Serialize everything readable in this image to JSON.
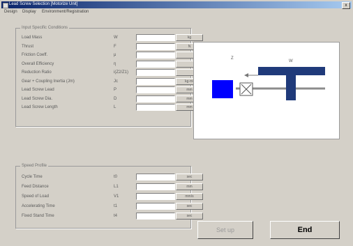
{
  "window": {
    "title": "Lead Screw Selection [Motorize Unit]",
    "close_glyph": "x"
  },
  "menu": [
    "Design",
    "Display",
    "Environment/Registration"
  ],
  "conditions": {
    "title": "Input Specific Conditions",
    "rows": [
      {
        "label": "Load Mass",
        "symbol": "W",
        "value": "",
        "unit": "kg"
      },
      {
        "label": "Thrust",
        "symbol": "F",
        "value": "",
        "unit": "N"
      },
      {
        "label": "Friction Coeff.",
        "symbol": "μ",
        "value": "",
        "unit": ""
      },
      {
        "label": "Overall Efficiency",
        "symbol": "η",
        "value": "",
        "unit": ""
      },
      {
        "label": "Reduction Ratio",
        "symbol": "i(Z2/Z1)",
        "value": "",
        "unit": ""
      },
      {
        "label": "Gear + Coupling Inertia (Jm)",
        "symbol": "Jc",
        "value": "",
        "unit": "kg·m²"
      },
      {
        "label": "Lead Screw Lead",
        "symbol": "P",
        "value": "",
        "unit": "mm"
      },
      {
        "label": "Lead Screw Dia.",
        "symbol": "D",
        "value": "",
        "unit": "mm"
      },
      {
        "label": "Lead Screw Length",
        "symbol": "L",
        "value": "",
        "unit": "mm"
      }
    ]
  },
  "profile": {
    "title": "Speed Profile",
    "rows": [
      {
        "label": "Cycle Time",
        "symbol": "t0",
        "value": "",
        "unit": "sec"
      },
      {
        "label": "Feed Distance",
        "symbol": "L1",
        "value": "",
        "unit": "mm"
      },
      {
        "label": "Speed of Load",
        "symbol": "V1",
        "value": "",
        "unit": "mm/s"
      },
      {
        "label": "Accelerating Time",
        "symbol": "t1",
        "value": "",
        "unit": "sec"
      },
      {
        "label": "Fixed Stand Time",
        "symbol": "t4",
        "value": "",
        "unit": "sec"
      }
    ]
  },
  "diagram": {
    "label_a": "Z",
    "label_b": "W"
  },
  "buttons": {
    "setup": "Set up",
    "end": "End"
  }
}
